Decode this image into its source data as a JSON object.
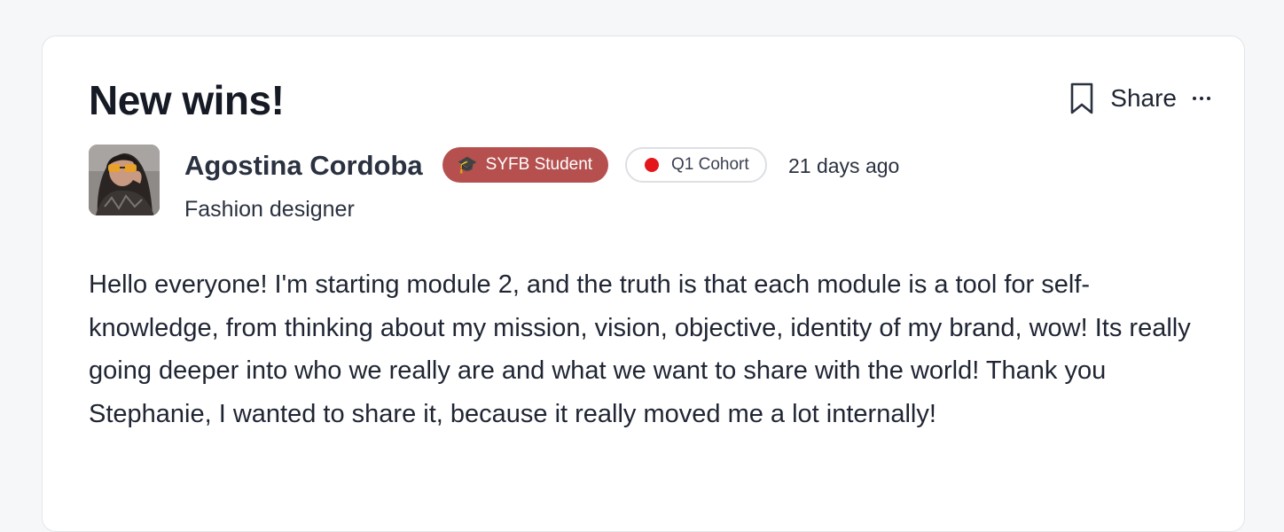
{
  "post": {
    "title": "New wins!",
    "author": {
      "name": "Agostina Cordoba",
      "headline": "Fashion designer"
    },
    "badges": {
      "student": {
        "icon": "graduation-cap-icon",
        "label": "SYFB Student",
        "color": "#b5504f"
      },
      "cohort": {
        "dot_color": "#e3171b",
        "label": "Q1 Cohort"
      }
    },
    "timestamp": "21 days ago",
    "body": "Hello everyone! I'm starting module 2, and the truth is that each module is a tool for self-knowledge, from thinking about my mission, vision, objective, identity of my brand, wow! Its really going deeper into who we really are and what we want to share with the world! Thank you Stephanie, I wanted to share it, because it really moved me a lot internally!"
  },
  "actions": {
    "bookmark_icon": "bookmark-icon",
    "share_label": "Share",
    "more_icon": "more-horizontal-icon"
  }
}
